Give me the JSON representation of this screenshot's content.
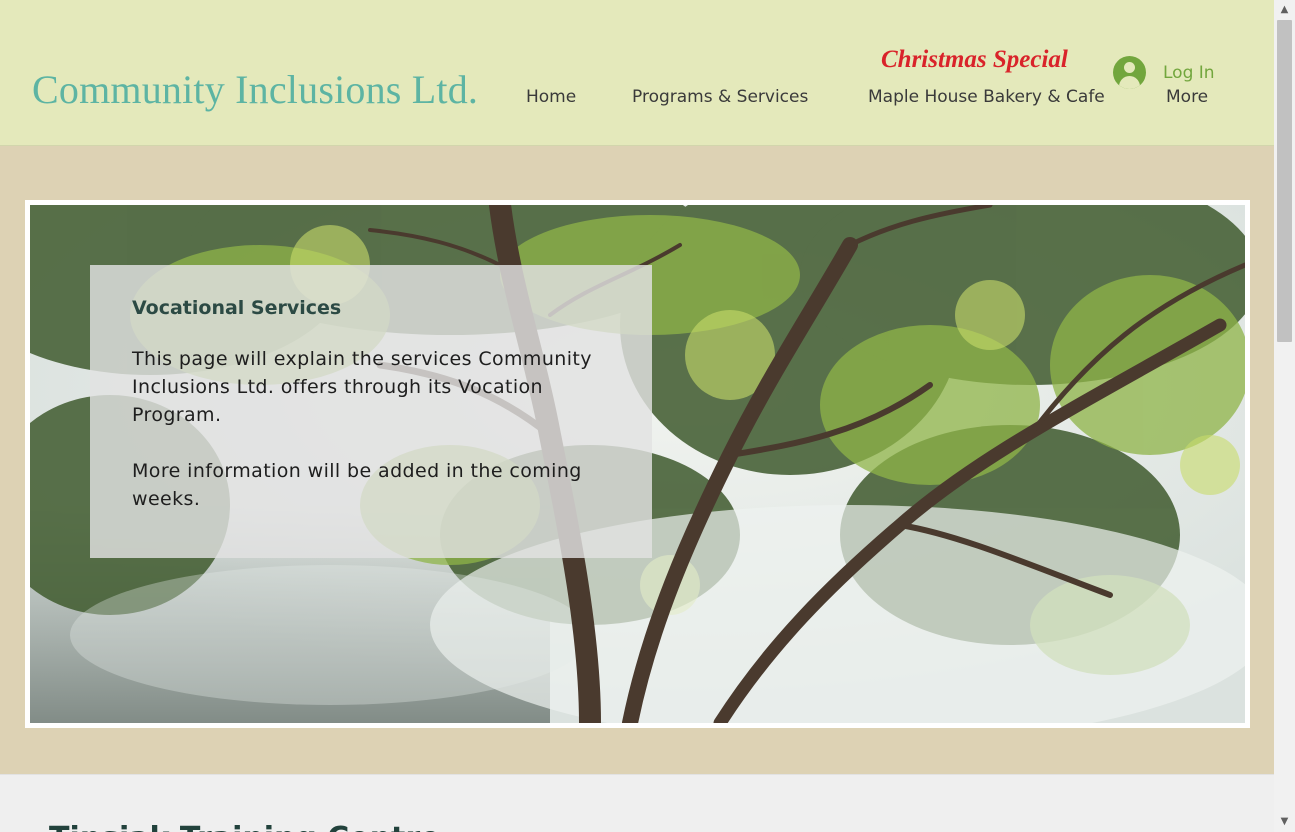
{
  "header": {
    "site_title": "Community Inclusions Ltd.",
    "promo_label": "Christmas Special",
    "login_label": "Log In",
    "avatar_icon": "user-avatar-icon",
    "nav": {
      "home": "Home",
      "programs": "Programs & Services",
      "bakery": "Maple House Bakery & Cafe",
      "more": "More"
    }
  },
  "hero": {
    "image": "tree-branches-in-mist-photo",
    "panel": {
      "heading": "Vocational Services",
      "paragraph_1": "This page will explain the services Community Inclusions Ltd. offers through its Vocation Program.",
      "paragraph_2": "More information will be added in the coming weeks."
    }
  },
  "lower_section": {
    "title": "Tinsiak Training Centre"
  },
  "colors": {
    "header_bg": "#e4e9bb",
    "title_teal": "#5db4a3",
    "promo_red": "#d9232a",
    "login_green": "#72a63d",
    "page_bg": "#ddd2b4"
  }
}
